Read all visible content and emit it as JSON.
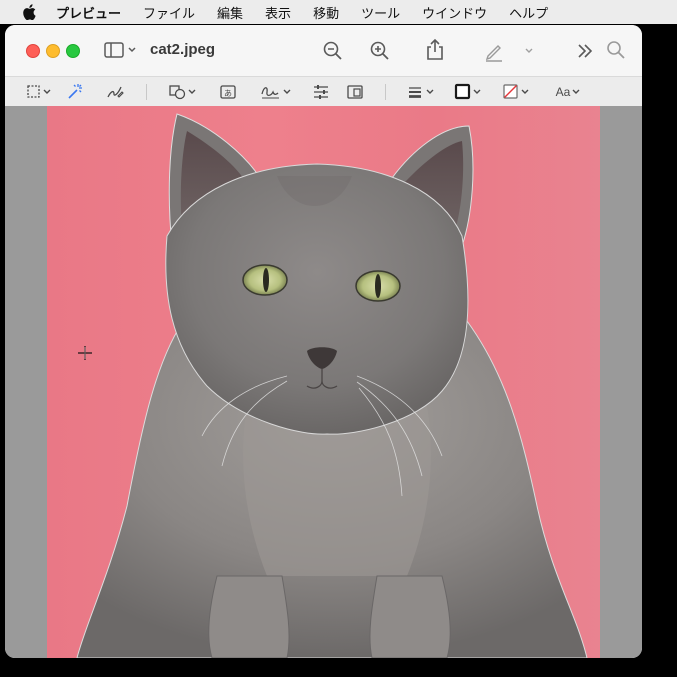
{
  "menubar": {
    "app_name": "プレビュー",
    "items": [
      "ファイル",
      "編集",
      "表示",
      "移動",
      "ツール",
      "ウインドウ",
      "ヘルプ"
    ]
  },
  "window": {
    "title": "cat2.jpeg"
  },
  "toolbar_icons": [
    "selection-tool-icon",
    "instant-alpha-icon",
    "sketch-icon",
    "shapes-icon",
    "text-icon",
    "sign-icon",
    "adjust-color-icon",
    "adjust-size-icon",
    "shape-style-icon",
    "border-color-icon",
    "fill-color-icon",
    "text-style-icon"
  ],
  "text_style_label": "Aa",
  "colors": {
    "background_pink": "#ec7d89",
    "cat_grey": "#7d7a7a",
    "eye_green": "#b9c287"
  }
}
